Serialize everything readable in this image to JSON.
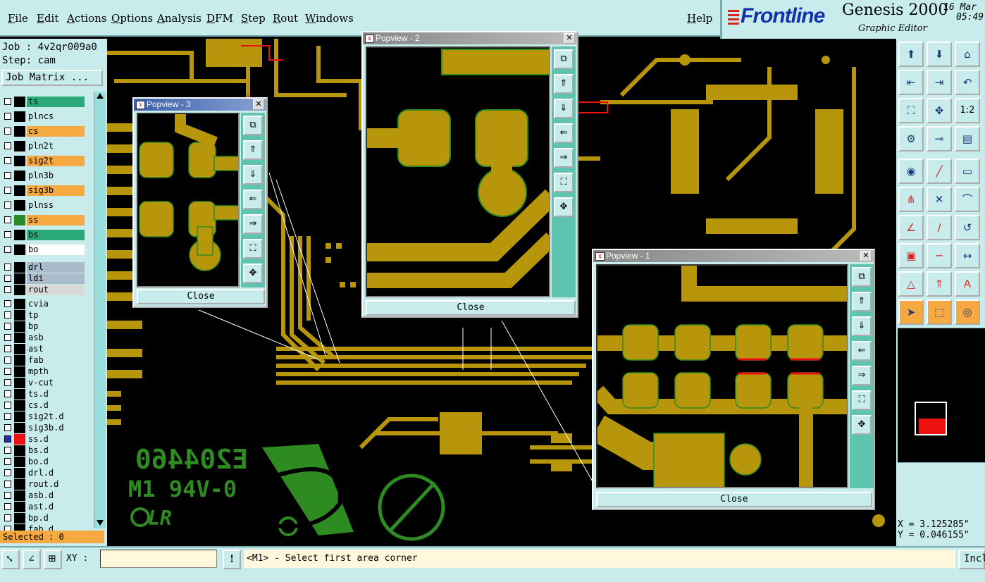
{
  "menu": [
    "File",
    "Edit",
    "Actions",
    "Options",
    "Analysis",
    "DFM",
    "Step",
    "Rout",
    "Windows"
  ],
  "help": "Help",
  "brand": {
    "logo": "Frontline",
    "product": "Genesis 2000",
    "subtitle": "Graphic Editor",
    "date": "16 Mar",
    "time": "05:49"
  },
  "job": {
    "job_label": "Job : 4v2qr009a0",
    "step_label": "Step: cam",
    "matrix_button": "Job Matrix ..."
  },
  "layers": [
    {
      "name": "ts",
      "color": "#2aa878",
      "swatch": "#000"
    },
    {
      "name": "plncs",
      "color": "#c8ecec",
      "swatch": "#000"
    },
    {
      "name": "cs",
      "color": "#f5a940",
      "swatch": "#000",
      "edit": true
    },
    {
      "name": "pln2t",
      "color": "#c8ecec",
      "swatch": "#000"
    },
    {
      "name": "sig2t",
      "color": "#f5a940",
      "swatch": "#000",
      "edit": true
    },
    {
      "name": "pln3b",
      "color": "#c8ecec",
      "swatch": "#000"
    },
    {
      "name": "sig3b",
      "color": "#f5a940",
      "swatch": "#000",
      "edit": true
    },
    {
      "name": "plnss",
      "color": "#c8ecec",
      "swatch": "#000"
    },
    {
      "name": "ss",
      "color": "#f5a940",
      "swatch": "#2a8a2a",
      "edit": true
    },
    {
      "name": "bs",
      "color": "#2aa878",
      "swatch": "#000"
    },
    {
      "name": "bo",
      "color": "#ffffff",
      "swatch": "#000",
      "edit": true
    },
    {
      "name": "drl",
      "color": "#aabbcc",
      "swatch": "#000"
    },
    {
      "name": "ldi",
      "color": "#aabbcc",
      "swatch": "#000"
    },
    {
      "name": "rout",
      "color": "#d8d8d8",
      "swatch": "#000"
    },
    {
      "name": "cvia",
      "color": "#c8ecec",
      "swatch": "#000"
    },
    {
      "name": "tp",
      "color": "#c8ecec",
      "swatch": "#000"
    },
    {
      "name": "bp",
      "color": "#c8ecec",
      "swatch": "#000"
    },
    {
      "name": "asb",
      "color": "#c8ecec",
      "swatch": "#000",
      "edit": true
    },
    {
      "name": "ast",
      "color": "#c8ecec",
      "swatch": "#000"
    },
    {
      "name": "fab",
      "color": "#c8ecec",
      "swatch": "#000"
    },
    {
      "name": "mpth",
      "color": "#c8ecec",
      "swatch": "#000"
    },
    {
      "name": "v-cut",
      "color": "#c8ecec",
      "swatch": "#000"
    },
    {
      "name": "ts.d",
      "color": "#c8ecec",
      "swatch": "#000"
    },
    {
      "name": "cs.d",
      "color": "#c8ecec",
      "swatch": "#000",
      "edit": true
    },
    {
      "name": "sig2t.d",
      "color": "#c8ecec",
      "swatch": "#000",
      "edit": true
    },
    {
      "name": "sig3b.d",
      "color": "#c8ecec",
      "swatch": "#000",
      "edit": true
    },
    {
      "name": "ss.d",
      "color": "#c8ecec",
      "swatch": "#e11",
      "edit": true,
      "active": true
    },
    {
      "name": "bs.d",
      "color": "#c8ecec",
      "swatch": "#000",
      "edit": true
    },
    {
      "name": "bo.d",
      "color": "#c8ecec",
      "swatch": "#000",
      "edit": true
    },
    {
      "name": "drl.d",
      "color": "#c8ecec",
      "swatch": "#000"
    },
    {
      "name": "rout.d",
      "color": "#c8ecec",
      "swatch": "#000"
    },
    {
      "name": "asb.d",
      "color": "#c8ecec",
      "swatch": "#000",
      "edit": true
    },
    {
      "name": "ast.d",
      "color": "#c8ecec",
      "swatch": "#000"
    },
    {
      "name": "bp.d",
      "color": "#c8ecec",
      "swatch": "#000"
    },
    {
      "name": "fab.d",
      "color": "#c8ecec",
      "swatch": "#000"
    }
  ],
  "selected": "Selected : 0",
  "silkscreen": {
    "part_number": "E204460",
    "rating": "M1 94V-0",
    "mark": "R",
    "cert": "LR"
  },
  "popviews": {
    "p1": {
      "title": "Popview - 1",
      "close": "Close"
    },
    "p2": {
      "title": "Popview - 2",
      "close": "Close"
    },
    "p3": {
      "title": "Popview - 3",
      "close": "Close"
    }
  },
  "toolbar_labels": {
    "ratio": "1:2"
  },
  "coords": {
    "x": "X = 3.125285\"",
    "y": "Y = 0.046155\""
  },
  "bottom": {
    "xy_label": "XY :",
    "xy_value": "",
    "message": "<M1> - Select first area corner",
    "incl": "Incl",
    "warning": "!"
  },
  "colors": {
    "copper": "#b8960c",
    "silk": "#2e8b22",
    "panel": "#c8ecec",
    "highlight": "#f5a940",
    "red": "#e11"
  }
}
